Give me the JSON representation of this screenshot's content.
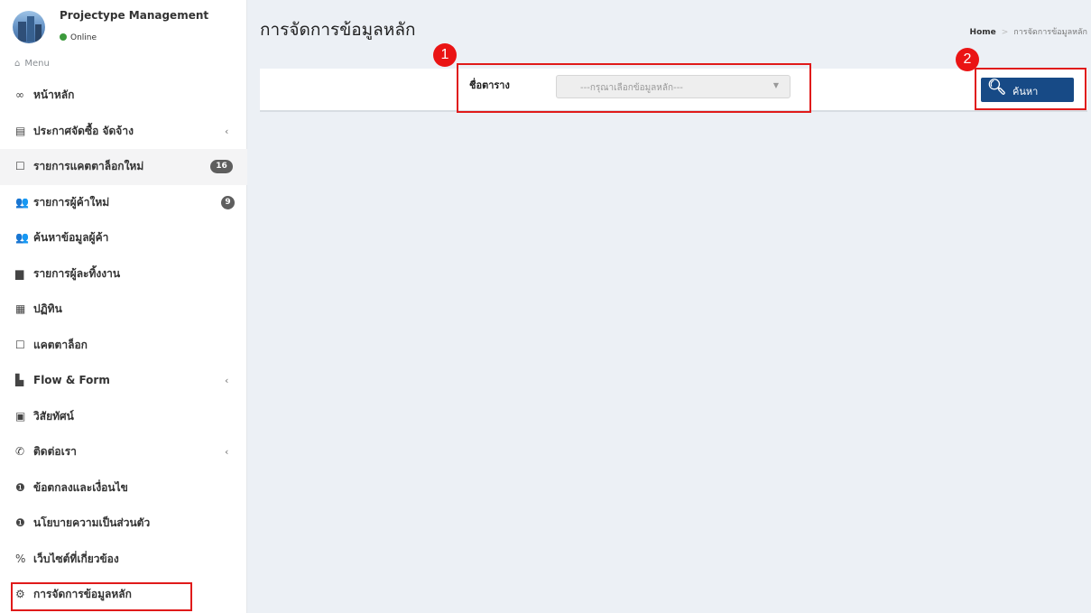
{
  "app": {
    "name": "Projectype Management",
    "status": "Online"
  },
  "sidebar": {
    "menu_header": "Menu",
    "items": [
      {
        "label": "หน้าหลัก",
        "icon": "dashboard-icon"
      },
      {
        "label": "ประกาศจัดซื้อ จัดจ้าง",
        "icon": "newspaper-icon",
        "arrow": "‹"
      },
      {
        "label": "รายการแคตตาล็อกใหม่",
        "icon": "square-icon",
        "badge": "16"
      },
      {
        "label": "รายการผู้ค้าใหม่",
        "icon": "users-icon",
        "badge": "9"
      },
      {
        "label": "ค้นหาข้อมูลผู้ค้า",
        "icon": "users-icon"
      },
      {
        "label": "รายการผู้ละทิ้งงาน",
        "icon": "file-icon"
      },
      {
        "label": "ปฏิทิน",
        "icon": "calendar-icon"
      },
      {
        "label": "แคตตาล็อก",
        "icon": "square-icon"
      },
      {
        "label": "Flow & Form",
        "icon": "files-icon",
        "arrow": "‹"
      },
      {
        "label": "วิสัยทัศน์",
        "icon": "image-icon"
      },
      {
        "label": "ติดต่อเรา",
        "icon": "whatsapp-icon",
        "arrow": "‹"
      },
      {
        "label": "ข้อตกลงและเงื่อนไข",
        "icon": "info-icon"
      },
      {
        "label": "นโยบายความเป็นส่วนตัว",
        "icon": "info-icon"
      },
      {
        "label": "เว็บไซต์ที่เกี่ยวข้อง",
        "icon": "link-icon"
      },
      {
        "label": "การจัดการข้อมูลหลัก",
        "icon": "gears-icon"
      }
    ]
  },
  "page": {
    "title": "การจัดการข้อมูลหลัก",
    "breadcrumb": {
      "home": "Home",
      "separator": ">",
      "current": "การจัดการข้อมูลหลัก"
    }
  },
  "filter": {
    "label": "ชื่อตาราง",
    "placeholder": "---กรุณาเลือกข้อมูลหลัก---"
  },
  "search_button": {
    "label": "ค้นหา"
  },
  "annotations": {
    "marker1": "1",
    "marker2": "2"
  },
  "colors": {
    "primary_button": "#174a86",
    "annotation_red": "#e01a1a",
    "badge": "#5e5e5e",
    "online": "#3c9a3c",
    "background": "#ecf0f5"
  }
}
